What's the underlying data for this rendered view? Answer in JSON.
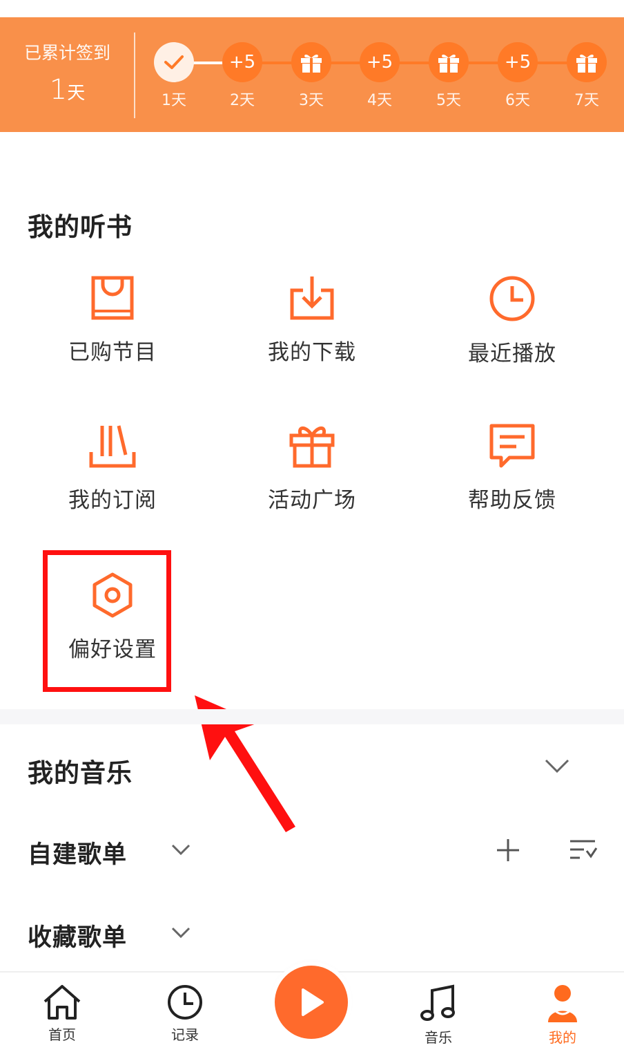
{
  "signin": {
    "total_label": "已累计签到",
    "total_value": "1",
    "total_unit": "天",
    "days": [
      {
        "label": "1天",
        "reward": "",
        "state": "checked"
      },
      {
        "label": "2天",
        "reward": "+5",
        "state": "bonus"
      },
      {
        "label": "3天",
        "reward": "gift",
        "state": "gift"
      },
      {
        "label": "4天",
        "reward": "+5",
        "state": "bonus"
      },
      {
        "label": "5天",
        "reward": "gift",
        "state": "gift"
      },
      {
        "label": "6天",
        "reward": "+5",
        "state": "bonus"
      },
      {
        "label": "7天",
        "reward": "gift",
        "state": "gift"
      }
    ]
  },
  "audiobook": {
    "title": "我的听书",
    "items": [
      {
        "label": "已购节目",
        "icon": "shopping-bag-icon"
      },
      {
        "label": "我的下载",
        "icon": "download-icon"
      },
      {
        "label": "最近播放",
        "icon": "clock-icon"
      },
      {
        "label": "我的订阅",
        "icon": "bookshelf-icon"
      },
      {
        "label": "活动广场",
        "icon": "gift-icon"
      },
      {
        "label": "帮助反馈",
        "icon": "message-icon"
      },
      {
        "label": "偏好设置",
        "icon": "settings-hexagon-icon"
      }
    ]
  },
  "music": {
    "title": "我的音乐",
    "created_playlists": "自建歌单",
    "saved_playlists": "收藏歌单"
  },
  "nav": {
    "items": [
      {
        "label": "首页",
        "icon": "home-icon"
      },
      {
        "label": "记录",
        "icon": "clock-icon"
      },
      {
        "label": "",
        "icon": "play-icon"
      },
      {
        "label": "音乐",
        "icon": "music-note-icon"
      },
      {
        "label": "我的",
        "icon": "profile-icon",
        "active": true
      }
    ]
  },
  "colors": {
    "accent": "#ff6a1e",
    "banner": "#f9904a",
    "annotation": "#ff1010"
  }
}
